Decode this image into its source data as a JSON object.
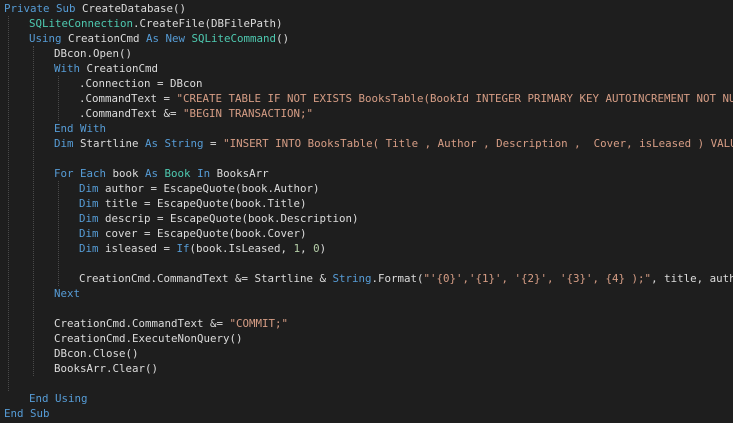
{
  "editor": {
    "colors": {
      "background": "#1e1e1e",
      "keyword": "#569cd6",
      "type": "#4ec9b0",
      "string": "#d69d85",
      "number": "#b5cea8",
      "plain": "#dcdcdc"
    },
    "lines": [
      {
        "indent": 0,
        "tokens": [
          [
            "kw",
            "Private Sub "
          ],
          [
            "id",
            "CreateDatabase()"
          ]
        ]
      },
      {
        "indent": 1,
        "tokens": [
          [
            "ty",
            "SQLiteConnection"
          ],
          [
            "id",
            ".CreateFile(DBFilePath)"
          ]
        ]
      },
      {
        "indent": 1,
        "tokens": [
          [
            "kw",
            "Using "
          ],
          [
            "id",
            "CreationCmd "
          ],
          [
            "kw",
            "As New "
          ],
          [
            "ty",
            "SQLiteCommand"
          ],
          [
            "id",
            "()"
          ]
        ]
      },
      {
        "indent": 2,
        "tokens": [
          [
            "id",
            "DBcon.Open()"
          ]
        ]
      },
      {
        "indent": 2,
        "tokens": [
          [
            "kw",
            "With "
          ],
          [
            "id",
            "CreationCmd"
          ]
        ]
      },
      {
        "indent": 3,
        "tokens": [
          [
            "id",
            ".Connection = DBcon"
          ]
        ]
      },
      {
        "indent": 3,
        "tokens": [
          [
            "id",
            ".CommandText = "
          ],
          [
            "str",
            "\"CREATE TABLE IF NOT EXISTS BooksTable(BookId INTEGER PRIMARY KEY AUTOINCREMENT NOT NULL,"
          ]
        ]
      },
      {
        "indent": 3,
        "tokens": [
          [
            "id",
            ".CommandText &= "
          ],
          [
            "str",
            "\"BEGIN TRANSACTION;\""
          ]
        ]
      },
      {
        "indent": 2,
        "tokens": [
          [
            "kw",
            "End With"
          ]
        ]
      },
      {
        "indent": 2,
        "tokens": [
          [
            "kw",
            "Dim "
          ],
          [
            "id",
            "Startline "
          ],
          [
            "kw",
            "As String "
          ],
          [
            "id",
            "= "
          ],
          [
            "str",
            "\"INSERT INTO BooksTable( Title , Author , Description ,  Cover, isLeased ) VALUES"
          ]
        ]
      },
      {
        "indent": 0,
        "tokens": []
      },
      {
        "indent": 2,
        "tokens": [
          [
            "kw",
            "For Each "
          ],
          [
            "id",
            "book "
          ],
          [
            "kw",
            "As "
          ],
          [
            "ty",
            "Book "
          ],
          [
            "kw",
            "In "
          ],
          [
            "id",
            "BooksArr"
          ]
        ]
      },
      {
        "indent": 3,
        "tokens": [
          [
            "kw",
            "Dim "
          ],
          [
            "id",
            "author = EscapeQuote(book.Author)"
          ]
        ]
      },
      {
        "indent": 3,
        "tokens": [
          [
            "kw",
            "Dim "
          ],
          [
            "id",
            "title = EscapeQuote(book.Title)"
          ]
        ]
      },
      {
        "indent": 3,
        "tokens": [
          [
            "kw",
            "Dim "
          ],
          [
            "id",
            "descrip = EscapeQuote(book.Description)"
          ]
        ]
      },
      {
        "indent": 3,
        "tokens": [
          [
            "kw",
            "Dim "
          ],
          [
            "id",
            "cover = EscapeQuote(book.Cover)"
          ]
        ]
      },
      {
        "indent": 3,
        "tokens": [
          [
            "kw",
            "Dim "
          ],
          [
            "id",
            "isleased = "
          ],
          [
            "kw",
            "If"
          ],
          [
            "id",
            "(book.IsLeased, "
          ],
          [
            "num",
            "1"
          ],
          [
            "id",
            ", "
          ],
          [
            "num",
            "0"
          ],
          [
            "id",
            ")"
          ]
        ]
      },
      {
        "indent": 0,
        "tokens": []
      },
      {
        "indent": 3,
        "tokens": [
          [
            "id",
            "CreationCmd.CommandText &= Startline & "
          ],
          [
            "kw",
            "String"
          ],
          [
            "id",
            ".Format("
          ],
          [
            "str",
            "\"'{0}','{1}', '{2}', '{3}', {4} );\""
          ],
          [
            "id",
            ", title, author,"
          ]
        ]
      },
      {
        "indent": 2,
        "tokens": [
          [
            "kw",
            "Next"
          ]
        ]
      },
      {
        "indent": 0,
        "tokens": []
      },
      {
        "indent": 2,
        "tokens": [
          [
            "id",
            "CreationCmd.CommandText &= "
          ],
          [
            "str",
            "\"COMMIT;\""
          ]
        ]
      },
      {
        "indent": 2,
        "tokens": [
          [
            "id",
            "CreationCmd.ExecuteNonQuery()"
          ]
        ]
      },
      {
        "indent": 2,
        "tokens": [
          [
            "id",
            "DBcon.Close()"
          ]
        ]
      },
      {
        "indent": 2,
        "tokens": [
          [
            "id",
            "BooksArr.Clear()"
          ]
        ]
      },
      {
        "indent": 0,
        "tokens": []
      },
      {
        "indent": 1,
        "tokens": [
          [
            "kw",
            "End Using"
          ]
        ]
      },
      {
        "indent": 0,
        "tokens": [
          [
            "kw",
            "End Sub"
          ]
        ]
      }
    ]
  }
}
